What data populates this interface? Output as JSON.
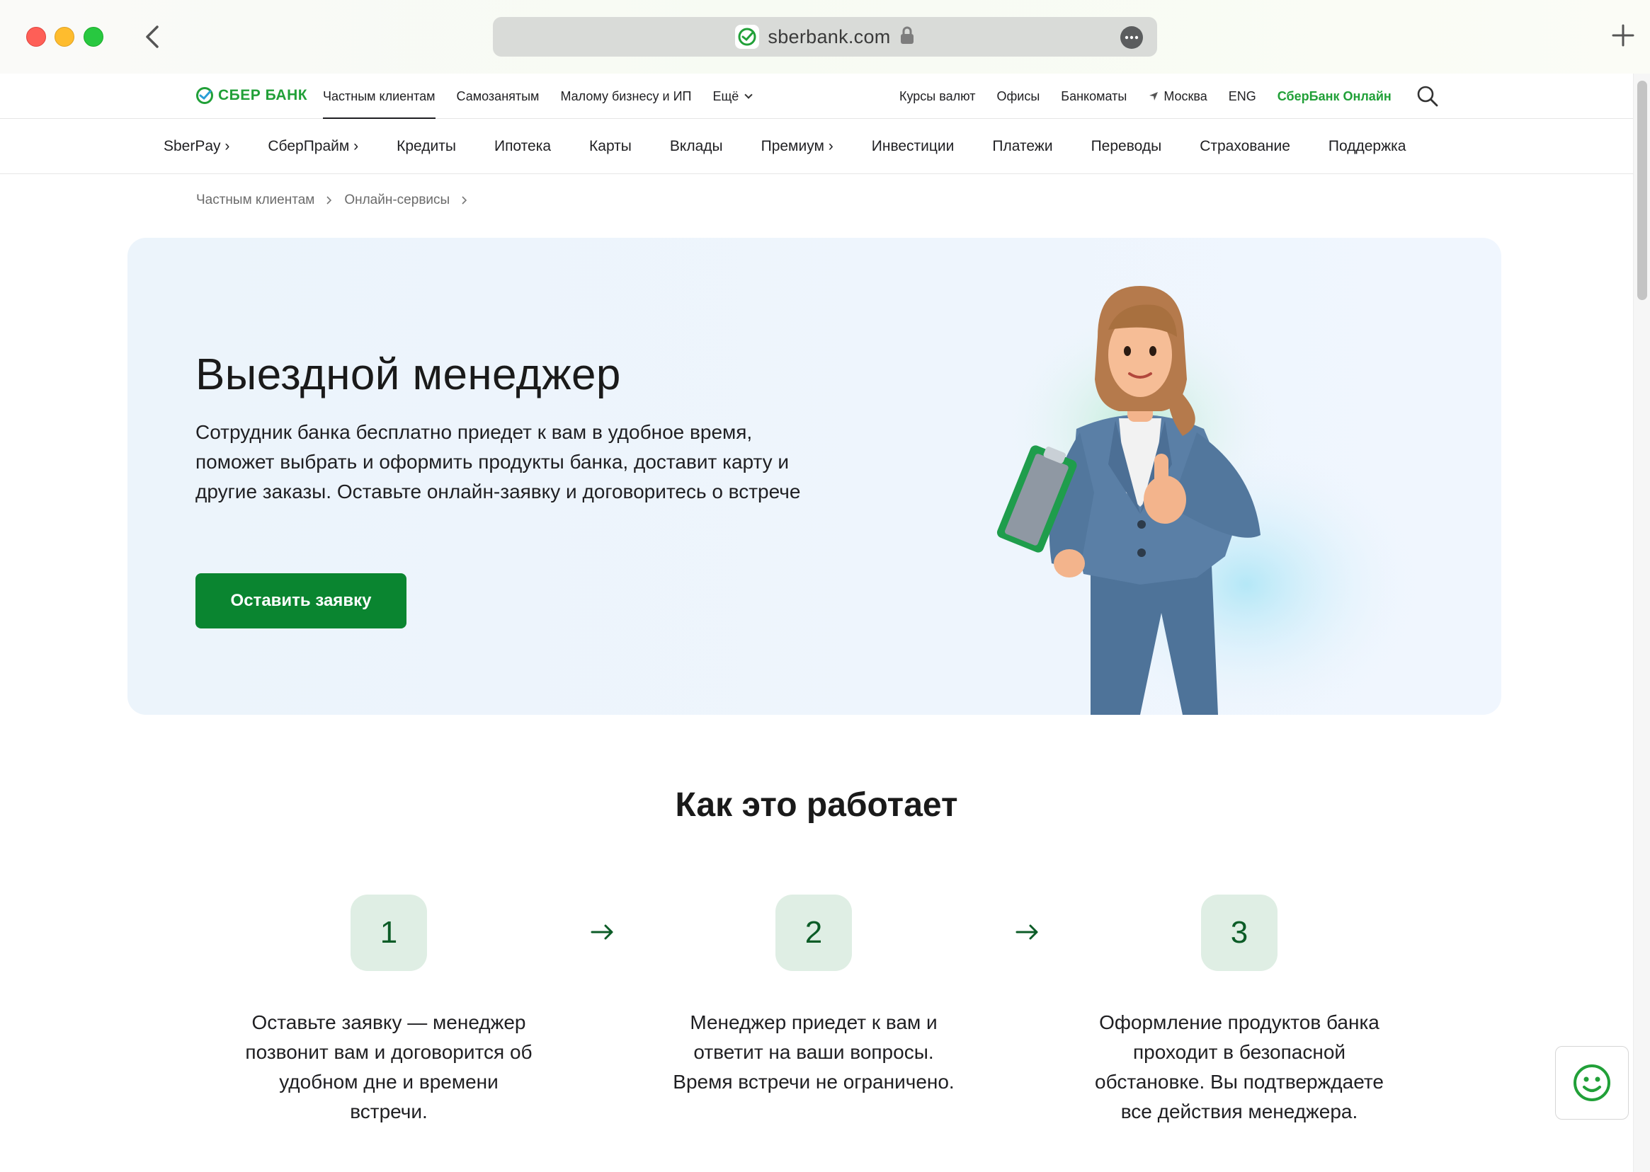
{
  "browser": {
    "url": "sberbank.com"
  },
  "logo": {
    "text": "СБЕР БАНК"
  },
  "topnav": {
    "left": [
      "Частным клиентам",
      "Самозанятым",
      "Малому бизнесу и ИП",
      "Ещё"
    ],
    "right": {
      "rates": "Курсы валют",
      "offices": "Офисы",
      "atms": "Банкоматы",
      "city": "Москва",
      "lang": "ENG",
      "online": "СберБанк Онлайн"
    }
  },
  "subnav": [
    "SberPay ›",
    "СберПрайм ›",
    "Кредиты",
    "Ипотека",
    "Карты",
    "Вклады",
    "Премиум ›",
    "Инвестиции",
    "Платежи",
    "Переводы",
    "Страхование",
    "Поддержка"
  ],
  "breadcrumb": [
    "Частным клиентам",
    "Онлайн-сервисы"
  ],
  "hero": {
    "title": "Выездной менеджер",
    "description": "Сотрудник банка бесплатно приедет к вам в удобное время, поможет выбрать и оформить продукты банка, доставит карту и другие заказы. Оставьте онлайн-заявку и договоритесь о встрече",
    "button": "Оставить заявку"
  },
  "how": {
    "title": "Как это работает",
    "steps": [
      {
        "num": "1",
        "text": "Оставьте заявку — менеджер позвонит вам и договорится об удобном дне и времени встречи."
      },
      {
        "num": "2",
        "text": "Менеджер приедет к вам и ответит на ваши вопросы. Время встречи не ограничено."
      },
      {
        "num": "3",
        "text": "Оформление продуктов банка проходит в безопасной обстановке. Вы подтверждаете все действия менеджера."
      }
    ]
  },
  "colors": {
    "brand": "#21a038",
    "button": "#0a8530",
    "step_bg": "#dfeee4",
    "hero_bg": "#eef5fd"
  }
}
